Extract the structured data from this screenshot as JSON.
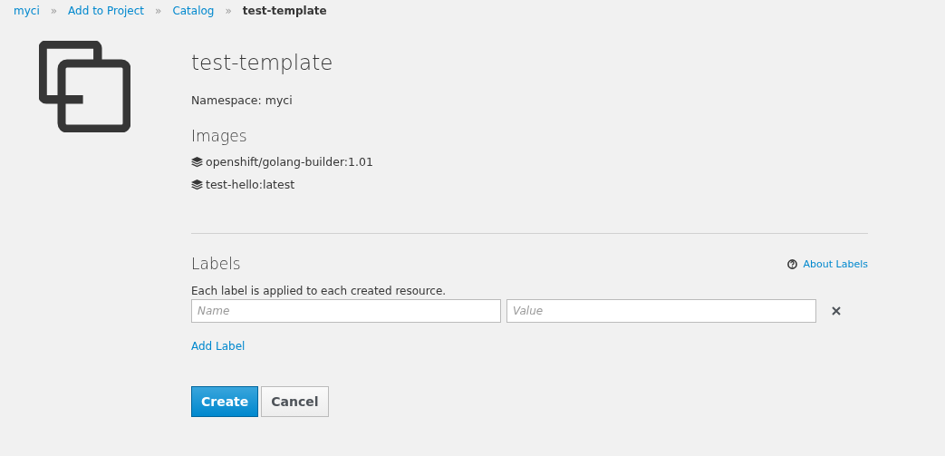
{
  "breadcrumb": [
    {
      "label": "myci",
      "current": false
    },
    {
      "label": "Add to Project",
      "current": false
    },
    {
      "label": "Catalog",
      "current": false
    },
    {
      "label": "test-template",
      "current": true
    }
  ],
  "separator": "»",
  "template": {
    "title": "test-template",
    "namespace": "Namespace: myci"
  },
  "images": {
    "heading": "Images",
    "items": [
      "openshift/golang-builder:1.01",
      "test-hello:latest"
    ]
  },
  "labels": {
    "heading": "Labels",
    "help_link": "About Labels",
    "description": "Each label is applied to each created resource.",
    "rows": [
      {
        "name_placeholder": "Name",
        "value_placeholder": "Value"
      }
    ],
    "add_link": "Add Label"
  },
  "buttons": [
    {
      "label": "Create",
      "kind": "primary"
    },
    {
      "label": "Cancel",
      "kind": "default"
    }
  ]
}
